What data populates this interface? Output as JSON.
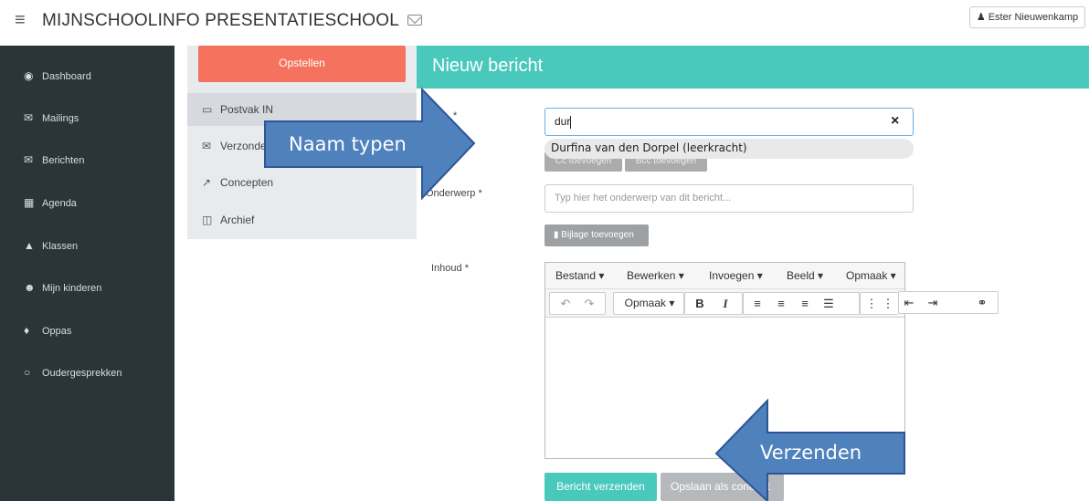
{
  "topbar": {
    "menu_icon": "hamburger-icon",
    "title": "MIJNSCHOOLINFO PRESENTATIESCHOOL",
    "mail_icon": "envelope-icon",
    "user_icon": "user-icon",
    "user_name": "Ester Nieuwenkamp"
  },
  "sidebar": {
    "items": [
      {
        "label": "Dashboard",
        "icon": "dashboard-icon"
      },
      {
        "label": "Mailings",
        "icon": "envelope-icon"
      },
      {
        "label": "Berichten",
        "icon": "envelope-icon"
      },
      {
        "label": "Agenda",
        "icon": "calendar-icon"
      },
      {
        "label": "Klassen",
        "icon": "sitemap-icon"
      },
      {
        "label": "Mijn kinderen",
        "icon": "users-icon"
      },
      {
        "label": "Oppas",
        "icon": "child-icon"
      },
      {
        "label": "Oudergesprekken",
        "icon": "comments-icon"
      }
    ]
  },
  "mailmenu": {
    "compose": "Opstellen",
    "items": [
      {
        "label": "Postvak IN",
        "icon": "inbox-icon"
      },
      {
        "label": "Verzonden",
        "icon": "envelope-icon"
      },
      {
        "label": "Concepten",
        "icon": "external-link-icon"
      },
      {
        "label": "Archief",
        "icon": "trash-icon"
      }
    ]
  },
  "main": {
    "title": "Nieuw bericht",
    "to_asterisk": "*",
    "to_value": "dur",
    "clear": "×",
    "suggestion": "Durfina van den Dorpel (leerkracht)",
    "cc_button": "Cc toevoegen",
    "bcc_button": "Bcc toevoegen",
    "subject_label": "Onderwerp *",
    "subject_placeholder": "Typ hier het onderwerp van dit bericht...",
    "attach_button": "Bijlage toevoegen",
    "content_label": "Inhoud *",
    "editor_menu": [
      "Bestand ▾",
      "Bewerken ▾",
      "Invoegen ▾",
      "Beeld ▾",
      "Opmaak ▾"
    ],
    "format_dropdown": "Opmaak ▾",
    "send_button": "Bericht verzenden",
    "draft_button": "Opslaan als concept"
  },
  "callouts": {
    "name": "Naam typen",
    "send": "Verzenden",
    "color": "#4f81bd"
  }
}
